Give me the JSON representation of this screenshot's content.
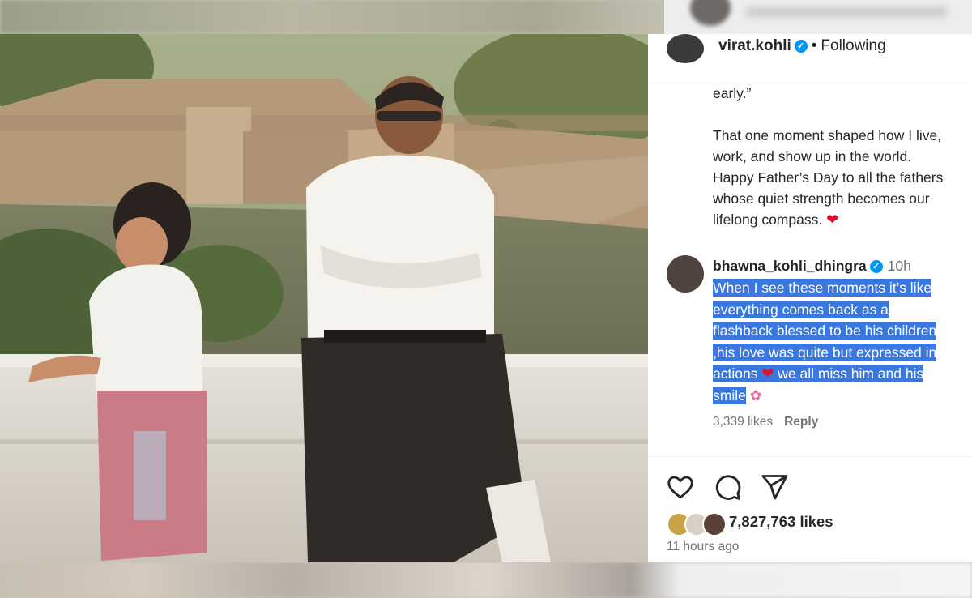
{
  "post": {
    "username": "virat.kohli",
    "separator": "•",
    "follow_status": "Following",
    "caption_lines": [
      "early.”",
      "",
      "That one moment shaped how I live,",
      "work, and show up in the world.",
      "Happy Father’s Day to all the fathers",
      "whose quiet strength becomes our",
      "lifelong compass."
    ],
    "likes": "7,827,763 likes",
    "time_ago": "11 hours ago"
  },
  "comment": {
    "username": "bhawna_kohli_dhingra",
    "time": "10h",
    "lines": [
      "When I see these moments it’s like",
      "everything comes back as a",
      "flashback blessed to be his children",
      ",his love was quite but expressed in",
      "actions",
      "we all miss him and his",
      "smile"
    ],
    "likes": "3,339 likes",
    "reply_label": "Reply"
  },
  "icons": {
    "verified": "verified-badge-icon",
    "heart_emoji": "red-heart-emoji",
    "flower_emoji": "cherry-blossom-emoji",
    "like": "heart-outline-icon",
    "comment": "speech-bubble-icon",
    "share": "paper-plane-icon"
  },
  "colors": {
    "verified": "#0095f6",
    "highlight": "#3a78e0",
    "heart": "#e0102a",
    "muted_text": "#737373"
  }
}
